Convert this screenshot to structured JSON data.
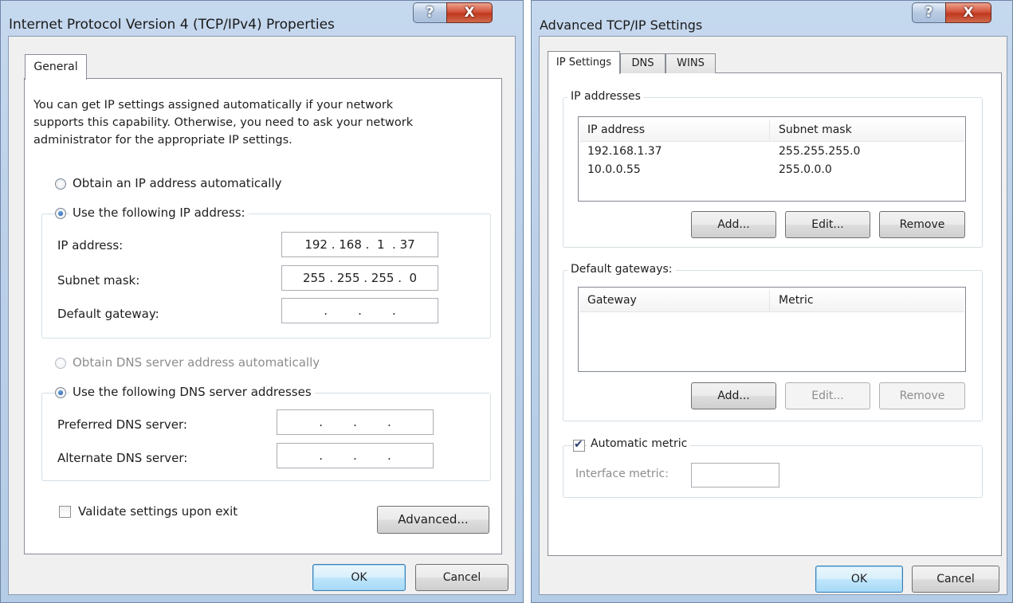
{
  "left_dialog": {
    "title": "Internet Protocol Version 4 (TCP/IPv4) Properties",
    "help_glyph": "?",
    "close_glyph": "X",
    "tab_general": "General",
    "description": [
      "You can get IP settings assigned automatically if your network",
      "supports this capability. Otherwise, you need to ask your network",
      "administrator for the appropriate IP settings."
    ],
    "radio_obtain_ip": "Obtain an IP address automatically",
    "radio_use_ip": "Use the following IP address:",
    "ip_address_label": "IP address:",
    "ip_address_value": "192 . 168 .  1  . 37",
    "subnet_mask_label": "Subnet mask:",
    "subnet_mask_value": "255 . 255 . 255 .  0",
    "default_gateway_label": "Default gateway:",
    "default_gateway_value": ".        .        .",
    "radio_obtain_dns": "Obtain DNS server address automatically",
    "radio_use_dns": "Use the following DNS server addresses",
    "preferred_dns_label": "Preferred DNS server:",
    "preferred_dns_value": ".        .        .",
    "alternate_dns_label": "Alternate DNS server:",
    "alternate_dns_value": ".        .        .",
    "validate_label": "Validate settings upon exit",
    "advanced_button": "Advanced...",
    "ok_button": "OK",
    "cancel_button": "Cancel"
  },
  "right_dialog": {
    "title": "Advanced TCP/IP Settings",
    "help_glyph": "?",
    "close_glyph": "X",
    "tabs": [
      "IP Settings",
      "DNS",
      "WINS"
    ],
    "ip_addresses_group": "IP addresses",
    "ip_table_headers": [
      "IP address",
      "Subnet mask"
    ],
    "ip_table_rows": [
      [
        "192.168.1.37",
        "255.255.255.0"
      ],
      [
        "10.0.0.55",
        "255.0.0.0"
      ]
    ],
    "add_button": "Add...",
    "edit_button": "Edit...",
    "remove_button": "Remove",
    "gateways_group": "Default gateways:",
    "gateway_headers": [
      "Gateway",
      "Metric"
    ],
    "gw_add_button": "Add...",
    "gw_edit_button": "Edit...",
    "gw_remove_button": "Remove",
    "automatic_metric_label": "Automatic metric",
    "interface_metric_label": "Interface metric:",
    "interface_metric_value": "",
    "ok_button": "OK",
    "cancel_button": "Cancel"
  }
}
